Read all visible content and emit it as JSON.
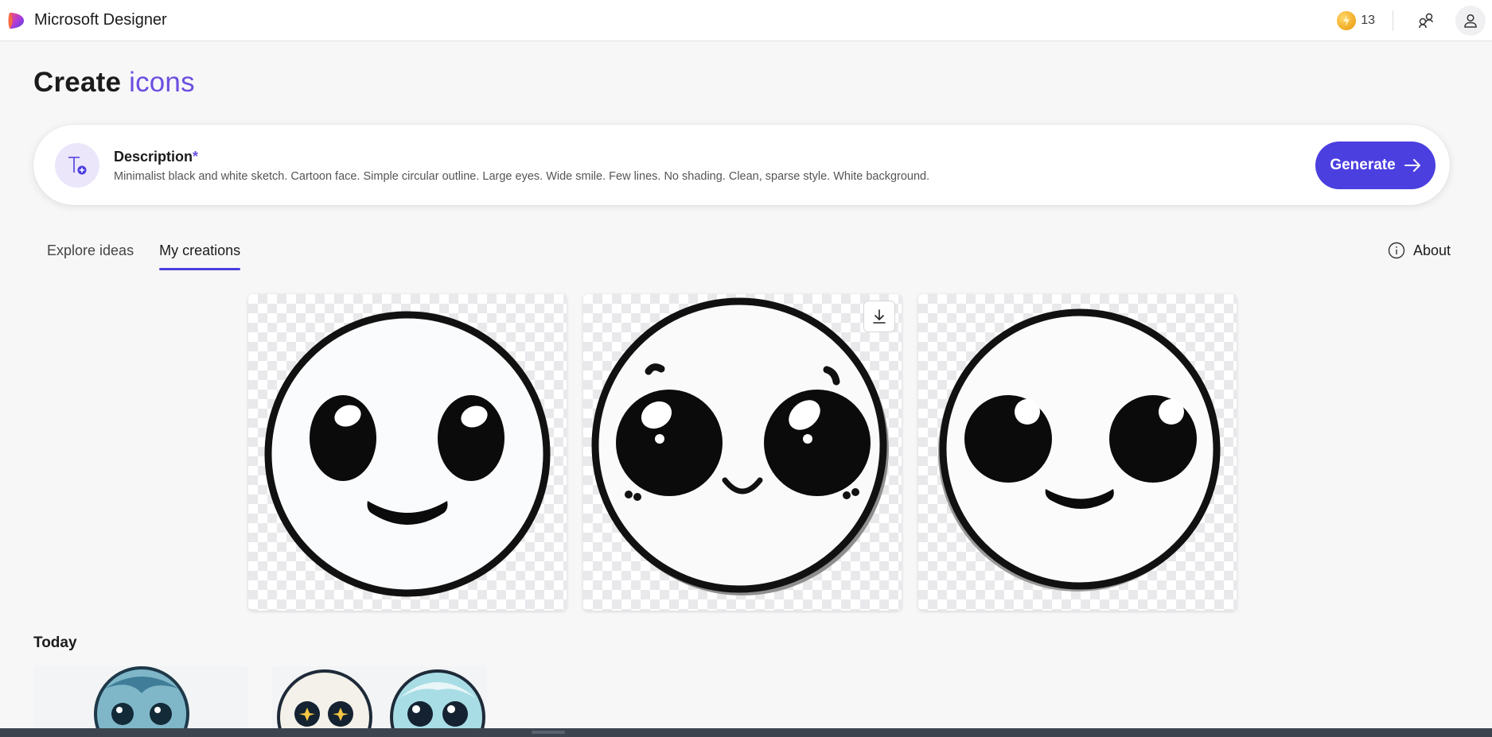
{
  "app": {
    "name": "Microsoft Designer",
    "credits": "13"
  },
  "page": {
    "title_prefix": "Create",
    "title_accent": "icons"
  },
  "prompt": {
    "label": "Description",
    "required_mark": "*",
    "text": "Minimalist black and white sketch. Cartoon face. Simple circular outline. Large eyes. Wide smile. Few lines. No shading. Clean, sparse style. White background.",
    "generate_label": "Generate"
  },
  "tabs": [
    {
      "label": "Explore ideas",
      "active": false
    },
    {
      "label": "My creations",
      "active": true
    }
  ],
  "about_label": "About",
  "section_today": "Today",
  "icons": {
    "logo": "designer-logo-icon",
    "coin": "coin-icon",
    "share": "share-icon",
    "account": "person-icon",
    "prompt": "text-add-icon",
    "arrow": "arrow-right-icon",
    "info": "info-icon",
    "download": "download-icon"
  },
  "colors": {
    "accent": "#4b3fe0",
    "title_accent": "#6c4fe0",
    "prompt_icon_bg": "#ece6fb"
  }
}
